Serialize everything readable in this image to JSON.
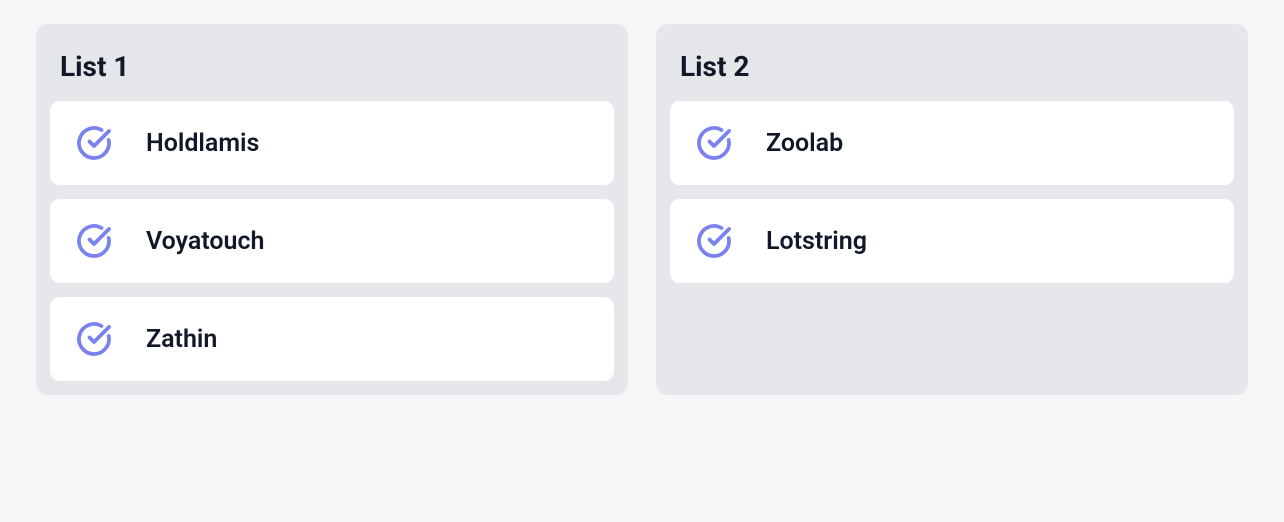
{
  "lists": [
    {
      "title": "List 1",
      "items": [
        {
          "label": "Holdlamis"
        },
        {
          "label": "Voyatouch"
        },
        {
          "label": "Zathin"
        }
      ]
    },
    {
      "title": "List 2",
      "items": [
        {
          "label": "Zoolab"
        },
        {
          "label": "Lotstring"
        }
      ]
    }
  ]
}
